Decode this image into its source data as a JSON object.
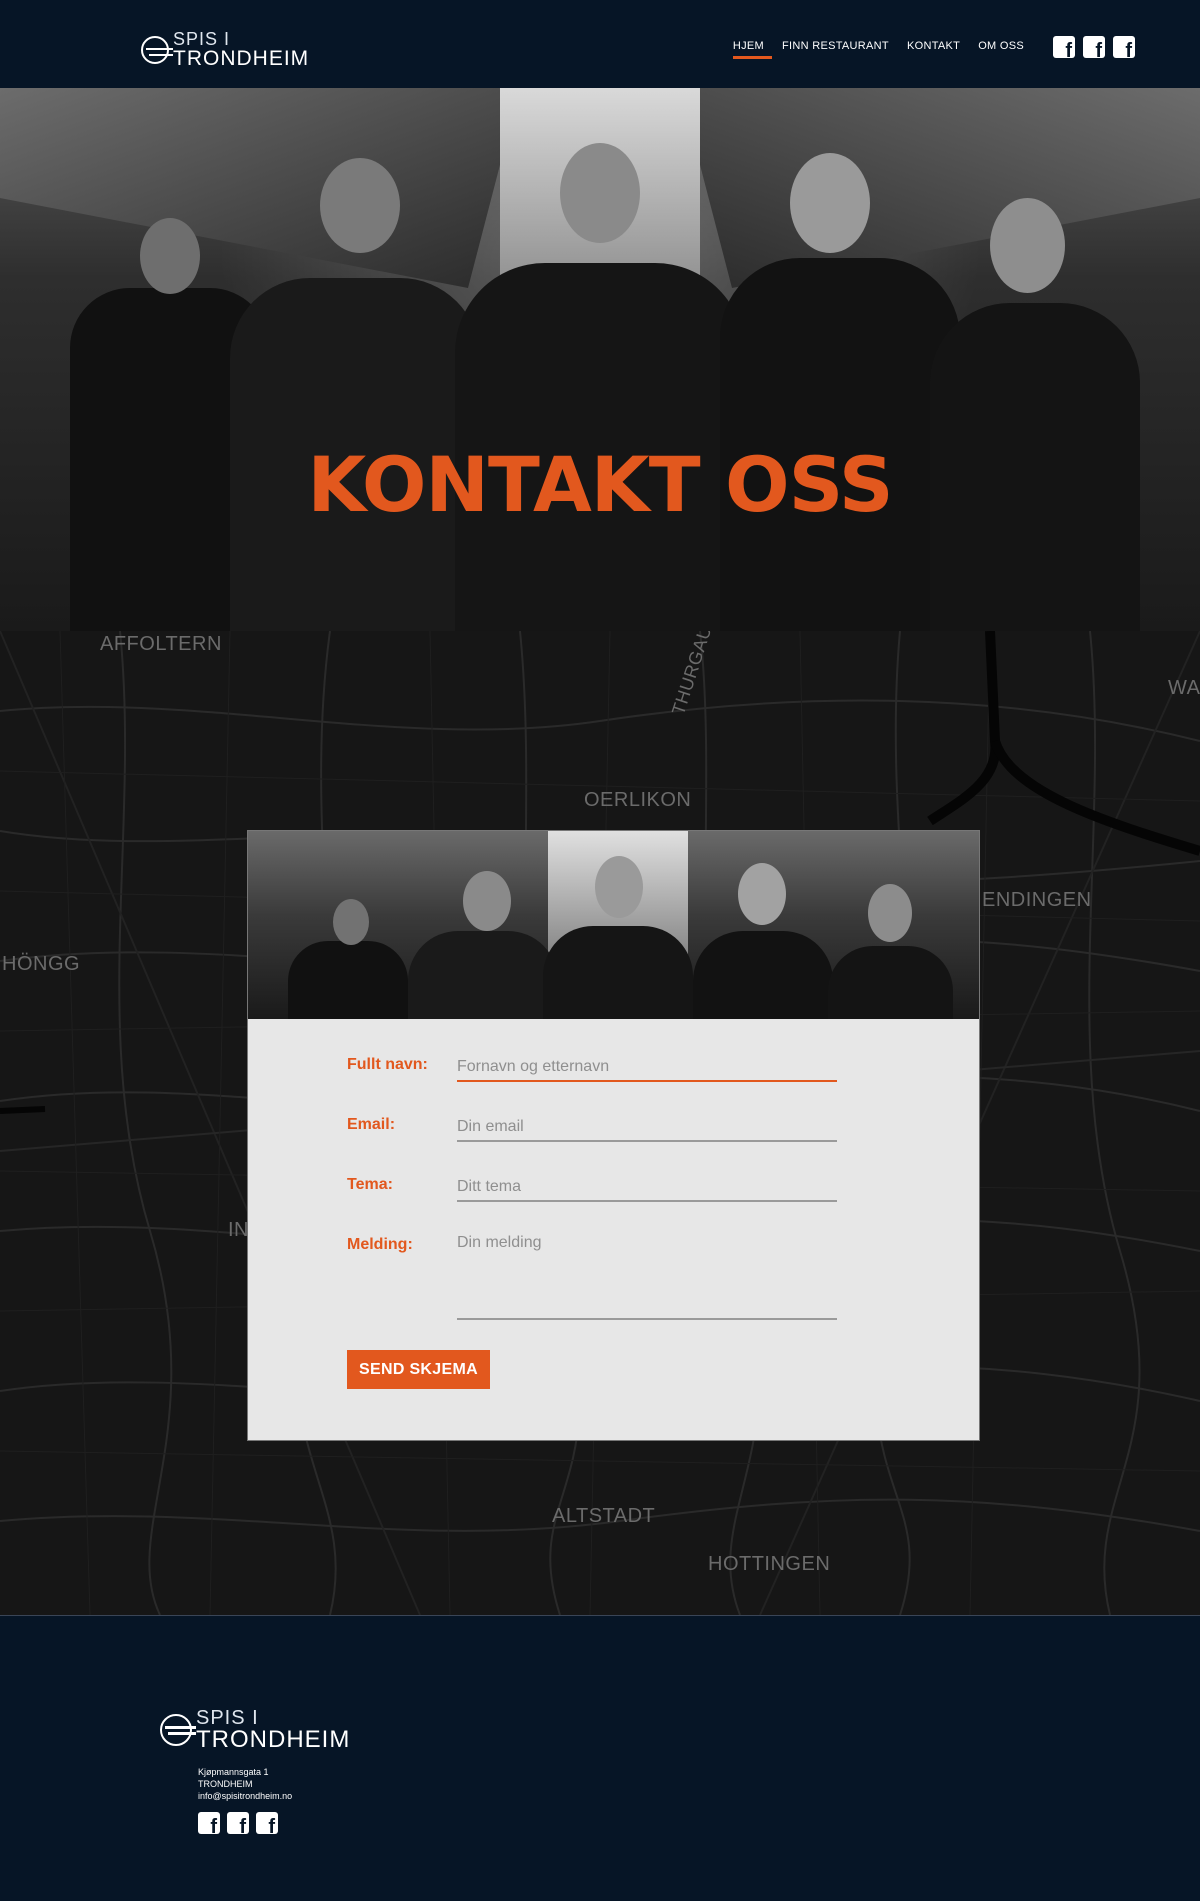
{
  "brand": {
    "line1": "SPIS I",
    "line2": "TRONDHEIM"
  },
  "nav": {
    "items": [
      {
        "label": "HJEM",
        "active": true
      },
      {
        "label": "FINN RESTAURANT",
        "active": false
      },
      {
        "label": "KONTAKT",
        "active": false
      },
      {
        "label": "OM OSS",
        "active": false
      }
    ],
    "social_icons": [
      "facebook-icon",
      "facebook-icon",
      "facebook-icon"
    ]
  },
  "hero": {
    "title": "KONTAKT OSS"
  },
  "map": {
    "labels": [
      "AFFOLTERN",
      "THURGAUERSTR",
      "OERLIKON",
      "WA",
      "ENDINGEN",
      "HÖNGG",
      "IN",
      "ALTSTADT",
      "HOTTINGEN"
    ]
  },
  "form": {
    "name": {
      "label": "Fullt navn:",
      "placeholder": "Fornavn og etternavn"
    },
    "email": {
      "label": "Email:",
      "placeholder": "Din email"
    },
    "topic": {
      "label": "Tema:",
      "placeholder": "Ditt tema"
    },
    "message": {
      "label": "Melding:",
      "placeholder": "Din melding"
    },
    "submit": "SEND SKJEMA"
  },
  "footer": {
    "brand": {
      "line1": "SPIS I",
      "line2": "TRONDHEIM"
    },
    "address": "Kjøpmannsgata 1",
    "city": "TRONDHEIM",
    "email": "info@spisitrondheim.no"
  },
  "colors": {
    "accent": "#e2581e",
    "navy": "#061526",
    "card": "#e7e7e7"
  }
}
